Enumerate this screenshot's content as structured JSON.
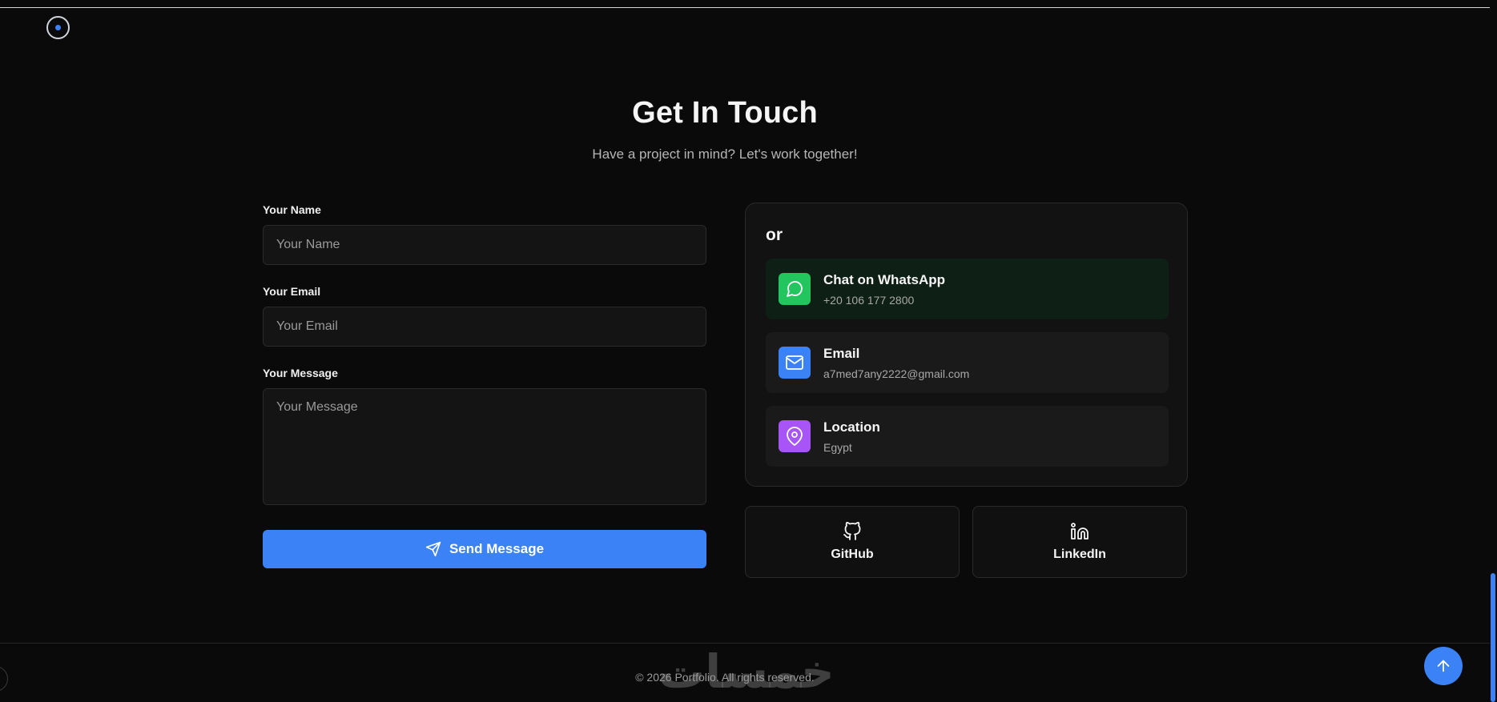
{
  "header": {
    "title": "Get In Touch",
    "subtitle": "Have a project in mind? Let's work together!"
  },
  "form": {
    "name_label": "Your Name",
    "name_placeholder": "Your Name",
    "email_label": "Your Email",
    "email_placeholder": "Your Email",
    "message_label": "Your Message",
    "message_placeholder": "Your Message",
    "send_label": "Send Message"
  },
  "contact": {
    "or_label": "or",
    "items": [
      {
        "title": "Chat on WhatsApp",
        "subtitle": "+20 106 177 2800",
        "icon": "whatsapp-icon",
        "color": "#22c55e"
      },
      {
        "title": "Email",
        "subtitle": "a7med7any2222@gmail.com",
        "icon": "mail-icon",
        "color": "#3b82f6"
      },
      {
        "title": "Location",
        "subtitle": "Egypt",
        "icon": "map-pin-icon",
        "color": "#a855f7"
      }
    ]
  },
  "social": {
    "github_label": "GitHub",
    "linkedin_label": "LinkedIn"
  },
  "footer": {
    "copyright": "© 2026 Portfolio. All rights reserved.",
    "watermark": "خمسات"
  },
  "colors": {
    "accent": "#3b82f6",
    "background": "#0a0a0a"
  }
}
